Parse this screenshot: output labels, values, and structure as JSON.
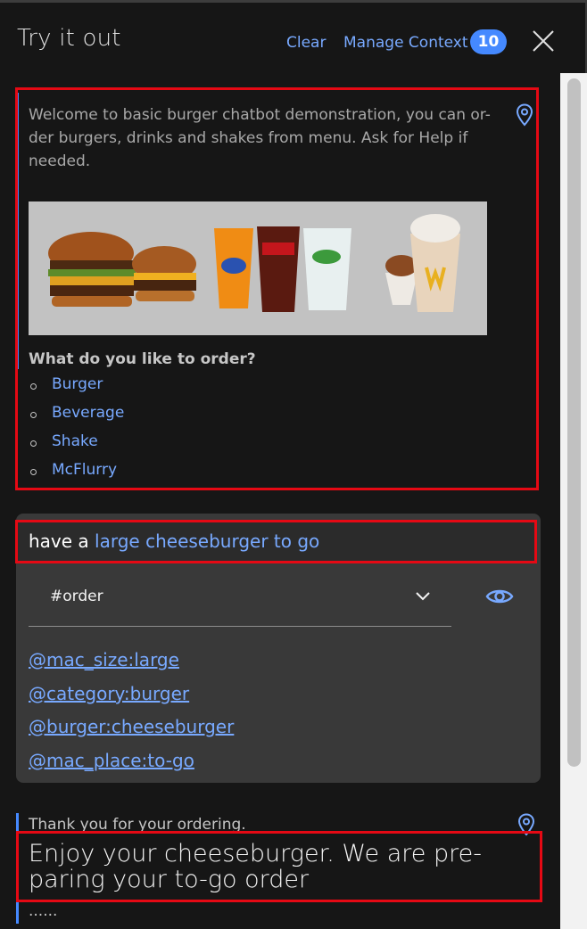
{
  "header": {
    "title": "Try it out",
    "clear_label": "Clear",
    "manage_context_label": "Manage Context",
    "context_count": "10"
  },
  "welcome": {
    "text": "Welcome to basic burger chatbot demonstration, you can or-der burgers, drinks and shakes from menu. Ask for Help if needed.",
    "question": "What do you like to order?",
    "options": [
      "Burger",
      "Beverage",
      "Shake",
      "McFlurry"
    ]
  },
  "user_message": {
    "prefix": "have a ",
    "highlighted": "large cheeseburger to go",
    "intent": "#order",
    "entities": [
      "@mac_size:large",
      "@category:burger",
      "@burger:cheeseburger",
      "@mac_place:to-go"
    ]
  },
  "bot_response": {
    "line1": "Thank you for your ordering.",
    "line2": "Enjoy your cheeseburger. We are pre-paring your to-go order",
    "line3": "......"
  },
  "colors": {
    "background": "#161616",
    "link": "#78a9ff",
    "badge": "#4589ff",
    "highlight_box": "#e50914",
    "user_card": "#393939"
  },
  "icons": [
    "close-icon",
    "location-pin-icon",
    "chevron-down-icon",
    "eye-icon"
  ]
}
